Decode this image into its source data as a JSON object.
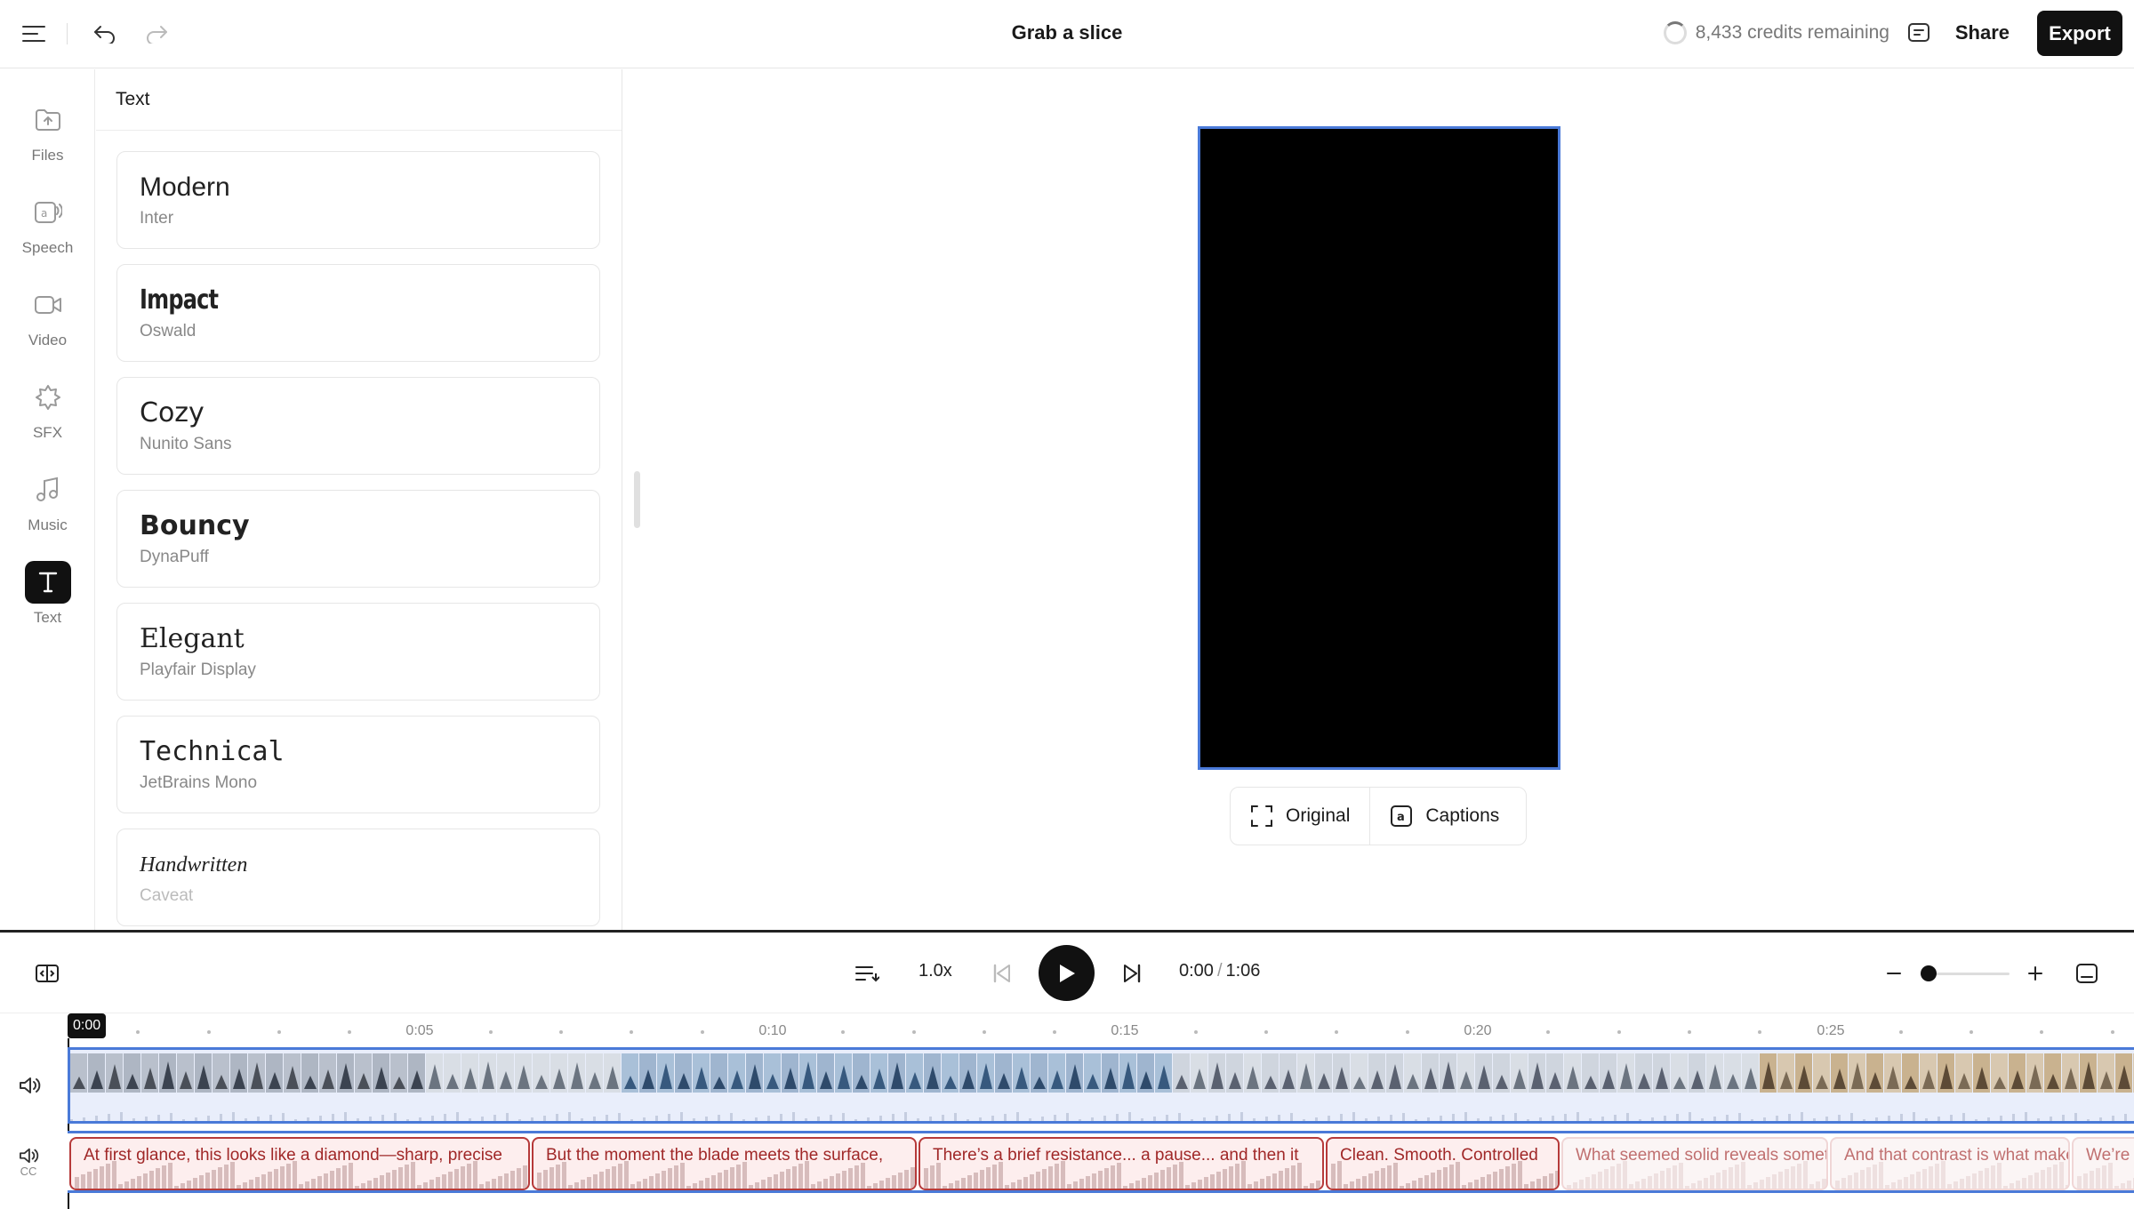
{
  "topbar": {
    "title": "Grab a slice",
    "credits": "8,433 credits remaining",
    "share_label": "Share",
    "export_label": "Export"
  },
  "rail": {
    "items": [
      {
        "label": "Files",
        "icon": "folder-icon"
      },
      {
        "label": "Speech",
        "icon": "speech-icon"
      },
      {
        "label": "Video",
        "icon": "video-icon"
      },
      {
        "label": "SFX",
        "icon": "sfx-icon"
      },
      {
        "label": "Music",
        "icon": "music-icon"
      },
      {
        "label": "Text",
        "icon": "text-icon",
        "active": true
      }
    ]
  },
  "panel": {
    "title": "Text",
    "fonts": [
      {
        "name": "Modern",
        "family": "Inter"
      },
      {
        "name": "Impact",
        "family": "Oswald"
      },
      {
        "name": "Cozy",
        "family": "Nunito Sans"
      },
      {
        "name": "Bouncy",
        "family": "DynaPuff"
      },
      {
        "name": "Elegant",
        "family": "Playfair Display"
      },
      {
        "name": "Technical",
        "family": "JetBrains Mono"
      },
      {
        "name": "Handwritten",
        "family": "Caveat"
      }
    ]
  },
  "stage": {
    "original_label": "Original",
    "captions_label": "Captions"
  },
  "timeline": {
    "speed": "1.0x",
    "current_time": "0:00",
    "separator": "/",
    "duration": "1:06",
    "playhead": "0:00",
    "ticks": [
      "0:05",
      "0:10",
      "0:15",
      "0:20",
      "0:25"
    ],
    "captions": [
      "At first glance, this looks like a diamond—sharp, precise",
      "But the moment the blade meets the surface,",
      "There’s a brief resistance... a pause... and then it",
      "Clean. Smooth. Controlled",
      "What seemed solid reveals something",
      "And that contrast is what makes",
      "We’re"
    ]
  },
  "colors": {
    "accent_blue": "#4a7ad8",
    "caption_red": "#b63a3a",
    "dark": "#111111"
  }
}
